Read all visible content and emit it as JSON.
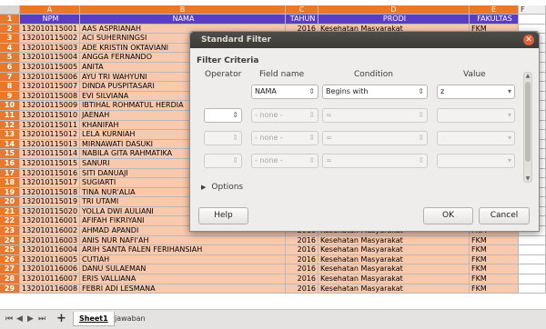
{
  "spreadsheet": {
    "columns": [
      "A",
      "B",
      "C",
      "D",
      "E",
      "F"
    ],
    "header": {
      "npm": "NPM",
      "nama": "NAMA",
      "tahun": "TAHUN",
      "prodi": "PRODI",
      "fakultas": "FAKULTAS"
    },
    "rows": [
      {
        "n": "1",
        "npm": "",
        "nama": "",
        "tahun": "",
        "prodi": "",
        "fak": ""
      },
      {
        "n": "2",
        "npm": "132010115001",
        "nama": "AAS ASPRIANAH",
        "tahun": "2016",
        "prodi": "Kesehatan Masyarakat",
        "fak": "FKM"
      },
      {
        "n": "3",
        "npm": "132010115002",
        "nama": "ACI SUHERNINGSI",
        "tahun": "",
        "prodi": "",
        "fak": ""
      },
      {
        "n": "4",
        "npm": "132010115003",
        "nama": "ADE KRISTIN OKTAVIANI",
        "tahun": "",
        "prodi": "",
        "fak": ""
      },
      {
        "n": "5",
        "npm": "132010115004",
        "nama": "ANGGA FERNANDO",
        "tahun": "",
        "prodi": "",
        "fak": ""
      },
      {
        "n": "6",
        "npm": "132010115005",
        "nama": "ANITA",
        "tahun": "",
        "prodi": "",
        "fak": ""
      },
      {
        "n": "7",
        "npm": "132010115006",
        "nama": "AYU TRI WAHYUNI",
        "tahun": "",
        "prodi": "",
        "fak": ""
      },
      {
        "n": "8",
        "npm": "132010115007",
        "nama": "DINDA PUSPITASARI",
        "tahun": "",
        "prodi": "",
        "fak": ""
      },
      {
        "n": "9",
        "npm": "132010115008",
        "nama": "EVI SILVIANA",
        "tahun": "",
        "prodi": "",
        "fak": ""
      },
      {
        "n": "10",
        "npm": "132010115009",
        "nama": "IBTIHAL ROHMATUL HERDIA",
        "tahun": "",
        "prodi": "",
        "fak": ""
      },
      {
        "n": "11",
        "npm": "132010115010",
        "nama": "JAENAH",
        "tahun": "",
        "prodi": "",
        "fak": ""
      },
      {
        "n": "12",
        "npm": "132010115011",
        "nama": "KHANIFAH",
        "tahun": "",
        "prodi": "",
        "fak": ""
      },
      {
        "n": "13",
        "npm": "132010115012",
        "nama": "LELA KURNIAH",
        "tahun": "",
        "prodi": "",
        "fak": ""
      },
      {
        "n": "14",
        "npm": "132010115013",
        "nama": "MIRNAWATI DASUKI",
        "tahun": "",
        "prodi": "",
        "fak": ""
      },
      {
        "n": "15",
        "npm": "132010115014",
        "nama": "NABILA GITA RAHMATIKA",
        "tahun": "",
        "prodi": "",
        "fak": ""
      },
      {
        "n": "16",
        "npm": "132010115015",
        "nama": "SANURI",
        "tahun": "",
        "prodi": "",
        "fak": ""
      },
      {
        "n": "17",
        "npm": "132010115016",
        "nama": "SITI DANUAJI",
        "tahun": "",
        "prodi": "",
        "fak": ""
      },
      {
        "n": "18",
        "npm": "132010115017",
        "nama": "SUGIARTI",
        "tahun": "",
        "prodi": "",
        "fak": ""
      },
      {
        "n": "19",
        "npm": "132010115018",
        "nama": "TINA NUR'ALIA",
        "tahun": "",
        "prodi": "",
        "fak": ""
      },
      {
        "n": "20",
        "npm": "132010115019",
        "nama": "TRI UTAMI",
        "tahun": "",
        "prodi": "",
        "fak": ""
      },
      {
        "n": "21",
        "npm": "132010115020",
        "nama": "YOLLA DWI AULIANI",
        "tahun": "",
        "prodi": "",
        "fak": ""
      },
      {
        "n": "22",
        "npm": "132010116001",
        "nama": "AFIFAH FIKRIYANI",
        "tahun": "",
        "prodi": "",
        "fak": ""
      },
      {
        "n": "23",
        "npm": "132010116002",
        "nama": "AHMAD APANDI",
        "tahun": "2016",
        "prodi": "Kesehatan Masyarakat",
        "fak": "FKM"
      },
      {
        "n": "24",
        "npm": "132010116003",
        "nama": "ANIS NUR NAFI'AH",
        "tahun": "2016",
        "prodi": "Kesehatan Masyarakat",
        "fak": "FKM"
      },
      {
        "n": "25",
        "npm": "132010116004",
        "nama": "ARIH SANTA FALEN FERIHANSIAH",
        "tahun": "2016",
        "prodi": "Kesehatan Masyarakat",
        "fak": "FKM"
      },
      {
        "n": "26",
        "npm": "132010116005",
        "nama": "CUTIAH",
        "tahun": "2016",
        "prodi": "Kesehatan Masyarakat",
        "fak": "FKM"
      },
      {
        "n": "27",
        "npm": "132010116006",
        "nama": "DANU SULAEMAN",
        "tahun": "2016",
        "prodi": "Kesehatan Masyarakat",
        "fak": "FKM"
      },
      {
        "n": "28",
        "npm": "132010116007",
        "nama": "ERIS VALLIANA",
        "tahun": "2016",
        "prodi": "Kesehatan Masyarakat",
        "fak": "FKM"
      },
      {
        "n": "29",
        "npm": "132010116008",
        "nama": "FEBRI ADI LESMANA",
        "tahun": "2016",
        "prodi": "Kesehatan Masyarakat",
        "fak": "FKM"
      }
    ]
  },
  "tabs": {
    "sheet1": "Sheet1",
    "jawaban": "jawaban"
  },
  "dialog": {
    "title": "Standard Filter",
    "section": "Filter Criteria",
    "col_operator": "Operator",
    "col_field": "Field name",
    "col_condition": "Condition",
    "col_value": "Value",
    "row1": {
      "field": "NAMA",
      "condition": "Begins with",
      "value": "z"
    },
    "row_none": "- none -",
    "row_eq": "=",
    "options": "Options",
    "help": "Help",
    "ok": "OK",
    "cancel": "Cancel"
  },
  "colors": {
    "row_header": "#e8782b",
    "header_row": "#5b3cc4",
    "cell_fill": "#f9c9ae"
  }
}
